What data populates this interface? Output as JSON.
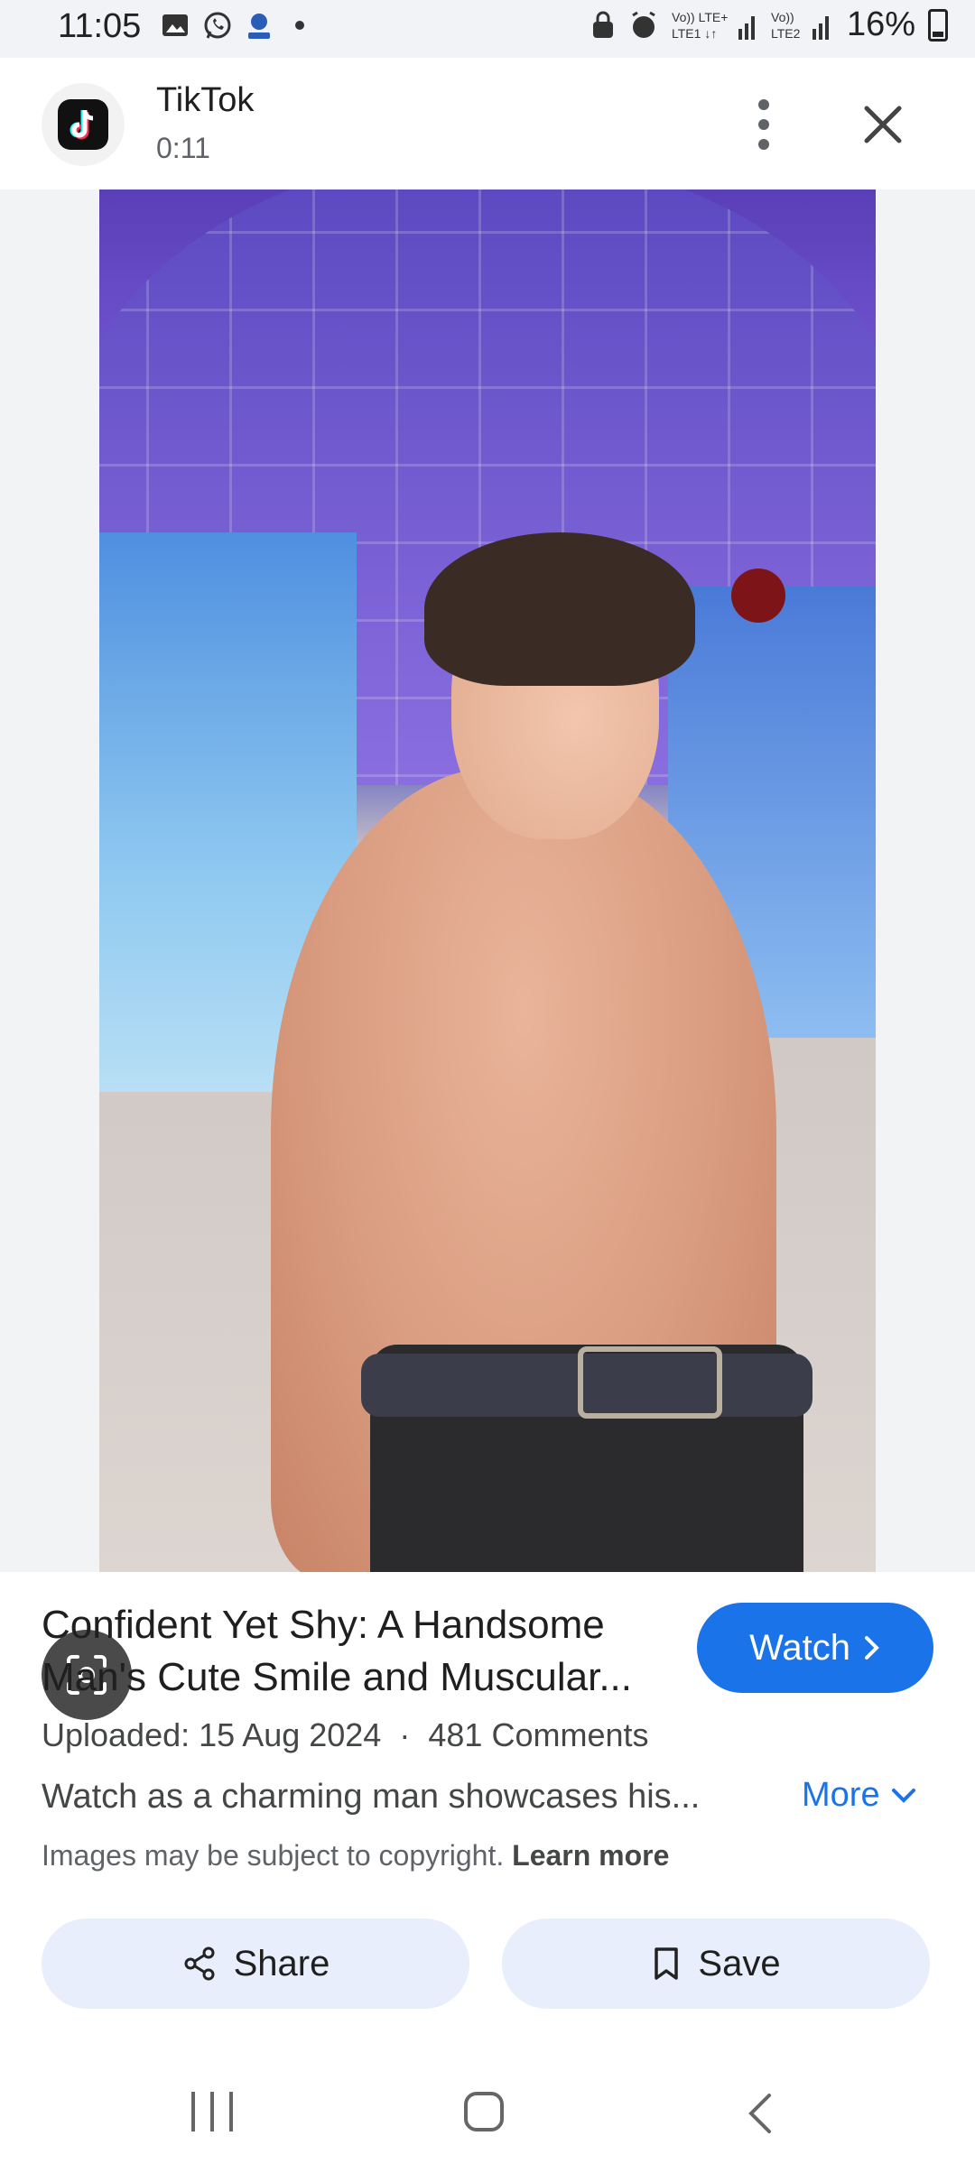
{
  "status_bar": {
    "time": "11:05",
    "battery": "16%"
  },
  "header": {
    "app_name": "TikTok",
    "duration": "0:11"
  },
  "result": {
    "title_line1": "Confident Yet Shy: A Handsome",
    "title_line2": "Man's Cute Smile and Muscular...",
    "watch_label": "Watch",
    "uploaded": "Uploaded: 15 Aug 2024",
    "separator": "·",
    "comments": "481 Comments",
    "description": "Watch as a charming man showcases his...",
    "more_label": "More",
    "copyright_text": "Images may be subject to copyright.",
    "learn_more": "Learn more"
  },
  "actions": {
    "share_label": "Share",
    "save_label": "Save"
  },
  "colors": {
    "accent": "#1a73e8",
    "action_bg": "#e8eefb"
  }
}
